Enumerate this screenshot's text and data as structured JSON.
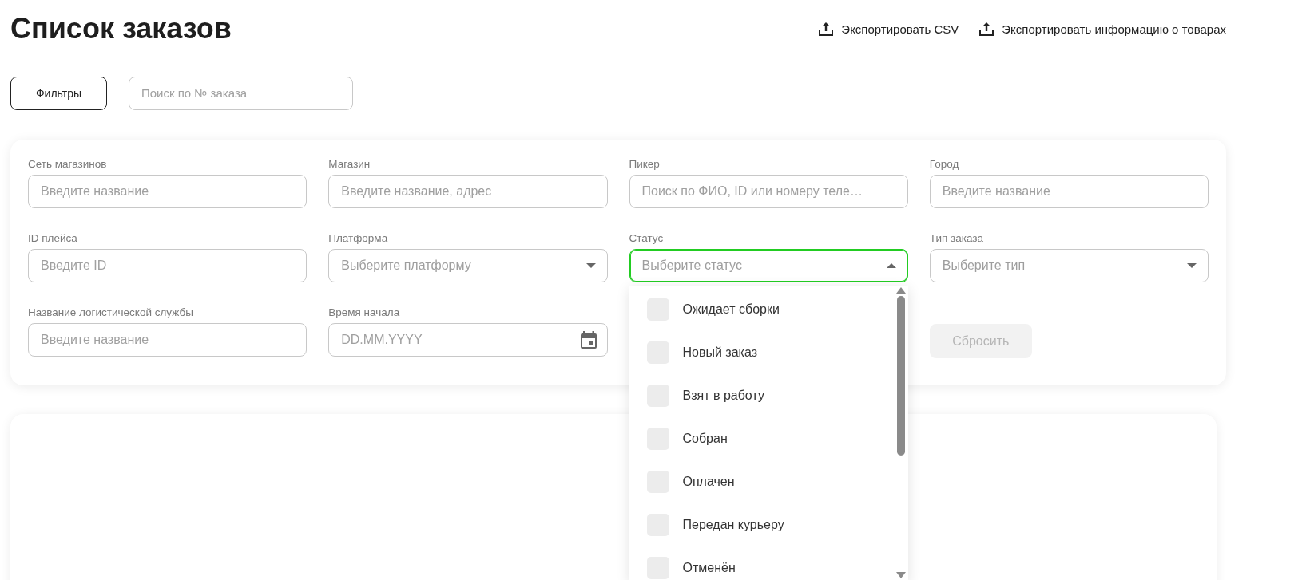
{
  "title": "Список заказов",
  "export_actions": [
    {
      "label": "Экспортировать CSV"
    },
    {
      "label": "Экспортировать информацию о товарах"
    }
  ],
  "filters_button": {
    "label": "Фильтры"
  },
  "order_search": {
    "placeholder": "Поиск по № заказа"
  },
  "filter_fields": [
    {
      "kind": "text",
      "label": "Сеть магазинов",
      "placeholder": "Введите название"
    },
    {
      "kind": "text",
      "label": "Магазин",
      "placeholder": "Введите название, адрес"
    },
    {
      "kind": "text",
      "label": "Пикер",
      "placeholder": "Поиск по ФИО, ID или номеру теле…"
    },
    {
      "kind": "text",
      "label": "Город",
      "placeholder": "Введите название"
    },
    {
      "kind": "text",
      "label": "ID плейса",
      "placeholder": "Введите ID"
    },
    {
      "kind": "select",
      "label": "Платформа",
      "placeholder": "Выберите платформу",
      "expanded": false
    },
    {
      "kind": "select",
      "label": "Статус",
      "placeholder": "Выберите статус",
      "expanded": true,
      "options": [
        {
          "label": "Ожидает сборки",
          "checked": false
        },
        {
          "label": "Новый заказ",
          "checked": false
        },
        {
          "label": "Взят в работу",
          "checked": false
        },
        {
          "label": "Собран",
          "checked": false
        },
        {
          "label": "Оплачен",
          "checked": false
        },
        {
          "label": "Передан курьеру",
          "checked": false
        },
        {
          "label": "Отменён",
          "checked": false
        }
      ]
    },
    {
      "kind": "select",
      "label": "Тип заказа",
      "placeholder": "Выберите тип",
      "expanded": false
    },
    {
      "kind": "text",
      "label": "Название логистической службы",
      "placeholder": "Введите название"
    },
    {
      "kind": "date",
      "label": "Время начала",
      "placeholder": "DD.MM.YYYY"
    }
  ],
  "reset_button": {
    "label": "Сбросить",
    "disabled": true
  }
}
